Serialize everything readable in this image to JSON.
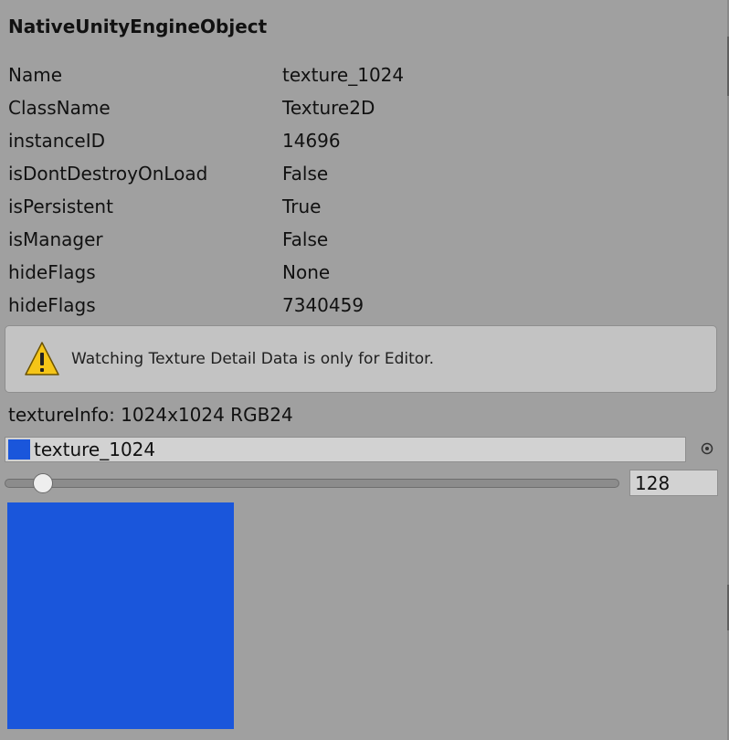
{
  "header": {
    "title": "NativeUnityEngineObject"
  },
  "properties": [
    {
      "key": "Name",
      "value": "texture_1024"
    },
    {
      "key": "ClassName",
      "value": "Texture2D"
    },
    {
      "key": "instanceID",
      "value": "14696"
    },
    {
      "key": "isDontDestroyOnLoad",
      "value": "False"
    },
    {
      "key": "isPersistent",
      "value": "True"
    },
    {
      "key": "isManager",
      "value": "False"
    },
    {
      "key": "hideFlags",
      "value": "None"
    },
    {
      "key": "hideFlags",
      "value": "7340459"
    }
  ],
  "help": {
    "text": "Watching Texture Detail Data is only for Editor.",
    "icon": "warning-icon"
  },
  "texture": {
    "info": "textureInfo: 1024x1024 RGB24",
    "object_name": "texture_1024",
    "color": "#1a56db",
    "size_value": "128"
  },
  "slider": {
    "fraction": 0.04
  }
}
